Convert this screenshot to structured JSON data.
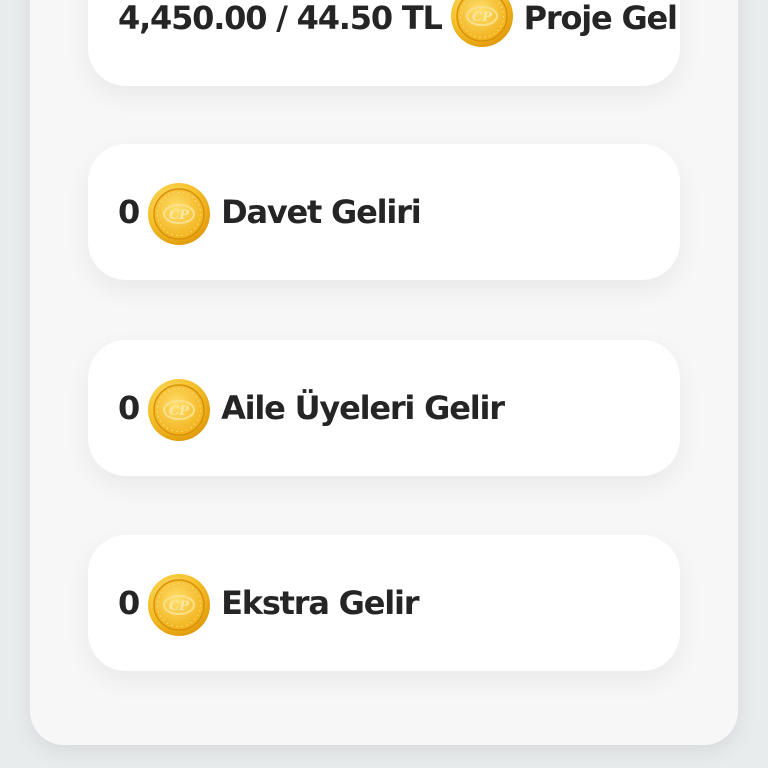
{
  "income_items": [
    {
      "amount": "4,450.00 / 44.50 TL",
      "label": "Proje Gel",
      "icon": "cp-coin-icon"
    },
    {
      "amount": "0",
      "label": "Davet Geliri",
      "icon": "cp-coin-icon"
    },
    {
      "amount": "0",
      "label": "Aile Üyeleri Gelir",
      "icon": "cp-coin-icon"
    },
    {
      "amount": "0",
      "label": "Ekstra Gelir",
      "icon": "cp-coin-icon"
    }
  ],
  "coin": {
    "text": "CP",
    "colors": {
      "outer": "#e9a40f",
      "inner": "#fbd24a",
      "text": "#f4bf2a"
    }
  }
}
